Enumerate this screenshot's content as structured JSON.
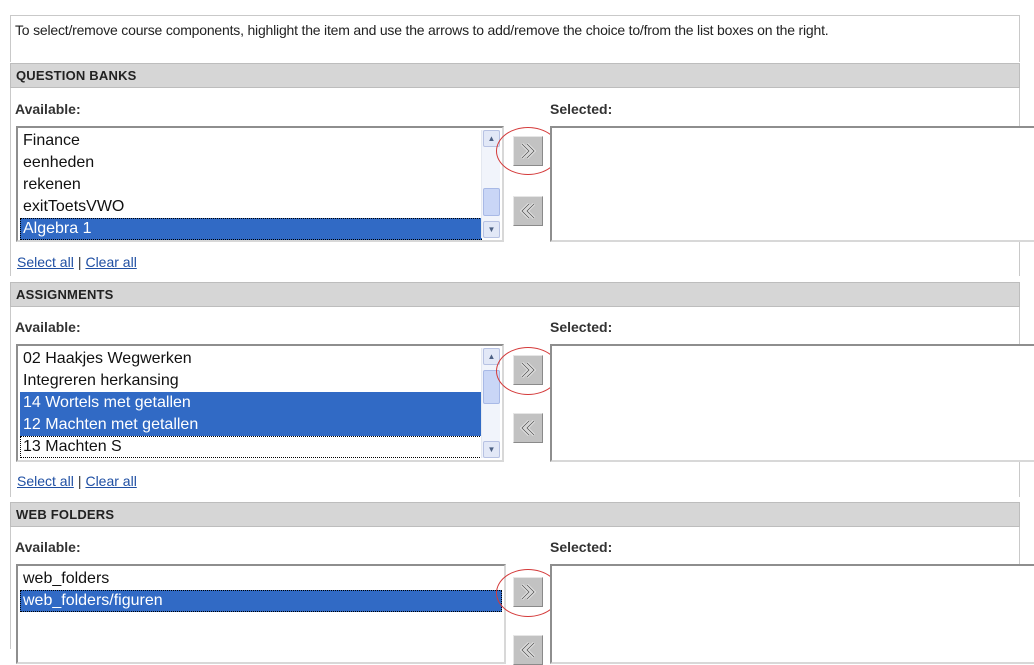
{
  "intro": "To select/remove course components, highlight the item and use the arrows to add/remove the choice to/from the list boxes on the right.",
  "labels": {
    "available": "Available:",
    "selected": "Selected:"
  },
  "links": {
    "select_all": "Select all",
    "separator": "|",
    "clear_all": "Clear all"
  },
  "sections": {
    "question_banks": {
      "title": "QUESTION BANKS",
      "available": [
        "Finance",
        "eenheden",
        "rekenen",
        "exitToetsVWO",
        "Algebra 1"
      ],
      "selected_index": [
        4
      ]
    },
    "assignments": {
      "title": "ASSIGNMENTS",
      "available": [
        "02 Haakjes Wegwerken",
        "Integreren herkansing",
        "14 Wortels met getallen",
        "12 Machten met getallen",
        "13 Machten S"
      ],
      "selected_index": [
        2,
        3
      ]
    },
    "web_folders": {
      "title": "WEB FOLDERS",
      "available": [
        "web_folders",
        "web_folders/figuren"
      ],
      "selected_index": [
        1
      ]
    }
  },
  "colors": {
    "highlight": "#316ac5",
    "annotation_circle": "#d43a3a",
    "header_bg": "#d6d6d6",
    "link": "#1f4fa3"
  },
  "icons": {
    "add": "double-chevron-right-icon",
    "remove": "double-chevron-left-icon"
  }
}
